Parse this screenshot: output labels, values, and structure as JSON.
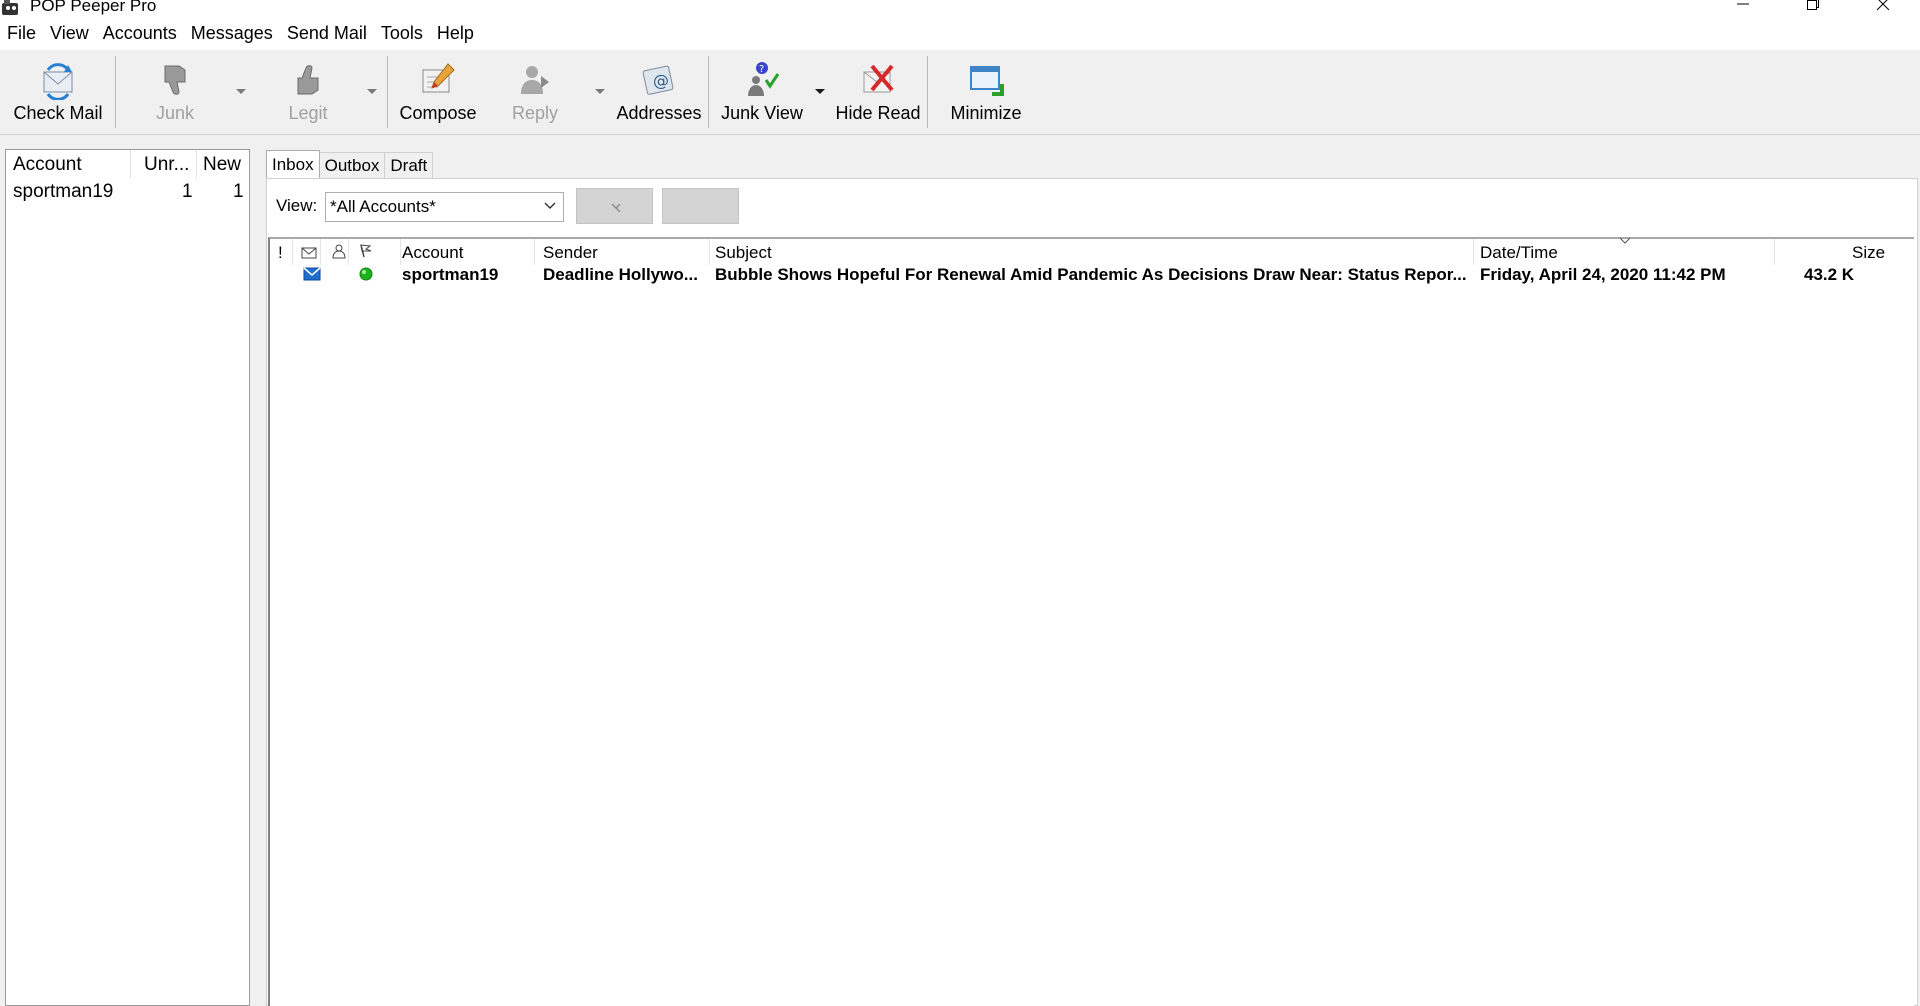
{
  "window": {
    "title": "POP Peeper Pro",
    "controls": [
      "minimize-icon",
      "maximize-icon",
      "close-icon"
    ]
  },
  "menu": [
    "File",
    "View",
    "Accounts",
    "Messages",
    "Send Mail",
    "Tools",
    "Help"
  ],
  "toolbar": {
    "check_mail": "Check Mail",
    "junk": "Junk",
    "legit": "Legit",
    "compose": "Compose",
    "reply": "Reply",
    "addresses": "Addresses",
    "junk_view": "Junk View",
    "hide_read": "Hide Read",
    "minimize": "Minimize"
  },
  "accounts_panel": {
    "headers": {
      "account": "Account",
      "unread": "Unr...",
      "new": "New"
    },
    "rows": [
      {
        "account": "sportman19",
        "unread": "1",
        "new": "1"
      }
    ]
  },
  "tabs": [
    "Inbox",
    "Outbox",
    "Draft"
  ],
  "active_tab": "Inbox",
  "view_filter": {
    "label": "View:",
    "selected": "*All Accounts*"
  },
  "message_list": {
    "columns": {
      "priority": "!",
      "account": "Account",
      "sender": "Sender",
      "subject": "Subject",
      "datetime": "Date/Time",
      "size": "Size"
    },
    "sorted_by": "Date/Time",
    "rows": [
      {
        "status_icon": "envelope-icon",
        "indicator_color": "#1db31d",
        "account": "sportman19",
        "sender": "Deadline Hollywo...",
        "subject": "Bubble Shows Hopeful For Renewal Amid Pandemic As Decisions Draw Near: Status Repor...",
        "datetime": "Friday, April 24, 2020 11:42 PM",
        "size": "43.2 K",
        "unread": true
      }
    ]
  },
  "colors": {
    "window_bg": "#f0f0f0",
    "pane_bg": "#ffffff",
    "disabled_text": "#a0a0a0",
    "button_grey": "#d4d4d4"
  }
}
